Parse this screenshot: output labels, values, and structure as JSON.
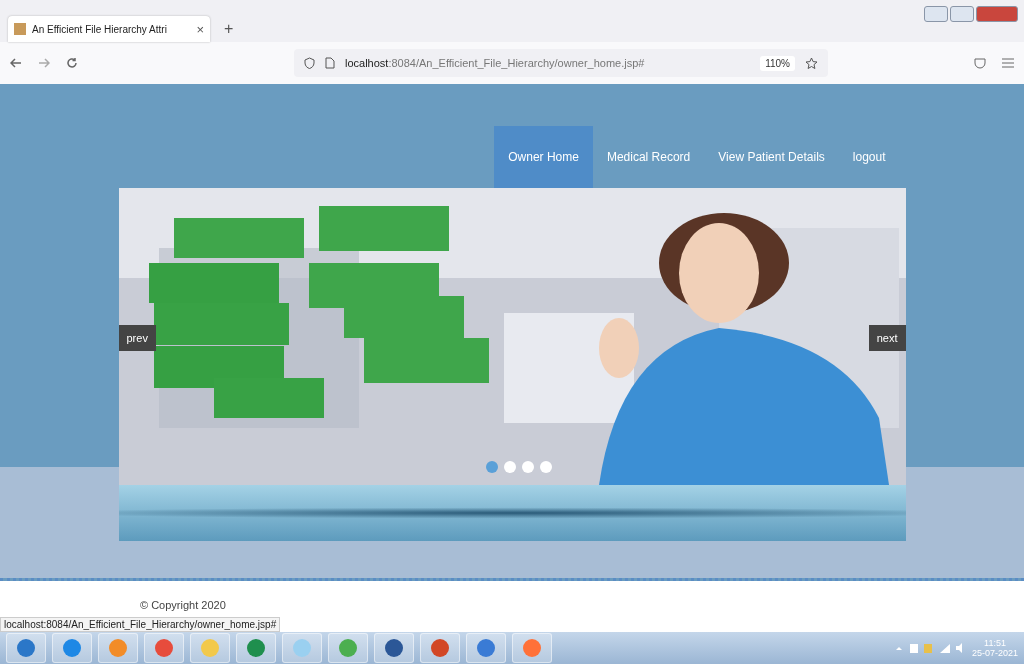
{
  "browser": {
    "tab": {
      "title": "An Efficient File Hierarchy Attri",
      "close": "×"
    },
    "new_tab": "+",
    "url": {
      "host": "localhost",
      "path": ":8084/An_Efficient_File_Hierarchy/owner_home.jsp#"
    },
    "zoom": "110%"
  },
  "nav": [
    {
      "label": "Owner Home",
      "selected": true
    },
    {
      "label": "Medical Record",
      "selected": false
    },
    {
      "label": "View Patient Details",
      "selected": false
    },
    {
      "label": "logout",
      "selected": false
    }
  ],
  "slider": {
    "prev": "prev",
    "next": "next",
    "dots": [
      {
        "selected": true
      },
      {
        "selected": false
      },
      {
        "selected": false
      },
      {
        "selected": false
      }
    ]
  },
  "footer": {
    "copyright": "© Copyright 2020"
  },
  "status_url": "localhost:8084/An_Efficient_File_Hierarchy/owner_home.jsp#",
  "taskbar": {
    "time": "11:51",
    "date": "25-07-2021"
  }
}
